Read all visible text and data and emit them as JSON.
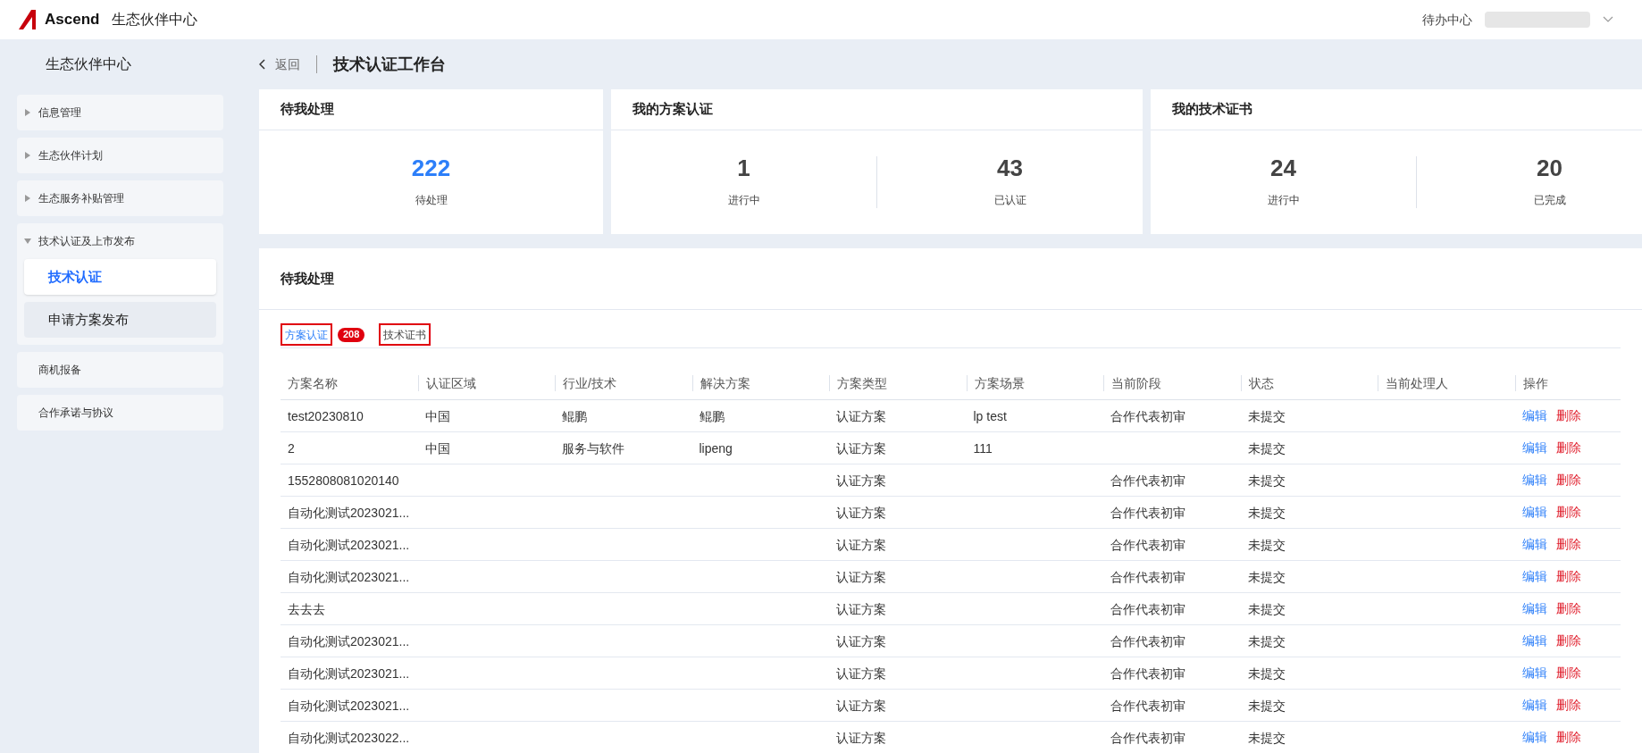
{
  "header": {
    "logo_text": "Ascend",
    "app_title": "生态伙伴中心",
    "todo_link": "待办中心"
  },
  "sidebar": {
    "title": "生态伙伴中心",
    "groups": [
      {
        "label": "信息管理",
        "kind": "folder",
        "expanded": false
      },
      {
        "label": "生态伙伴计划",
        "kind": "folder",
        "expanded": false
      },
      {
        "label": "生态服务补贴管理",
        "kind": "folder",
        "expanded": false
      },
      {
        "label": "技术认证及上市发布",
        "kind": "folder",
        "expanded": true,
        "children": [
          {
            "label": "技术认证",
            "selected": true
          },
          {
            "label": "申请方案发布",
            "selected": false
          }
        ]
      },
      {
        "label": "商机报备",
        "kind": "link"
      },
      {
        "label": "合作承诺与协议",
        "kind": "link"
      }
    ]
  },
  "page": {
    "back": "返回",
    "title": "技术认证工作台"
  },
  "cards": [
    {
      "title": "待我处理",
      "stats": [
        {
          "value": "222",
          "label": "待处理",
          "kind": "primary"
        }
      ]
    },
    {
      "title": "我的方案认证",
      "stats": [
        {
          "value": "1",
          "label": "进行中",
          "kind": "default"
        },
        {
          "value": "43",
          "label": "已认证",
          "kind": "default"
        }
      ]
    },
    {
      "title": "我的技术证书",
      "stats": [
        {
          "value": "24",
          "label": "进行中",
          "kind": "default"
        },
        {
          "value": "20",
          "label": "已完成",
          "kind": "default"
        }
      ]
    }
  ],
  "panel": {
    "title": "待我处理",
    "tabs": [
      {
        "label": "方案认证",
        "selected": true,
        "badge": "208"
      },
      {
        "label": "技术证书",
        "selected": false
      }
    ],
    "columns": [
      "方案名称",
      "认证区域",
      "行业/技术",
      "解决方案",
      "方案类型",
      "方案场景",
      "当前阶段",
      "状态",
      "当前处理人",
      "操作"
    ],
    "rows": [
      {
        "cells": [
          "test20230810",
          "中国",
          "鲲鹏",
          "鲲鹏",
          "认证方案",
          "lp test",
          "合作代表初审",
          "未提交",
          null
        ],
        "actions": [
          {
            "label": "编辑",
            "kind": "edit"
          },
          {
            "label": "删除",
            "kind": "delete"
          }
        ]
      },
      {
        "cells": [
          "2",
          "中国",
          "服务与软件",
          "lipeng",
          "认证方案",
          "111",
          null,
          "未提交",
          null
        ],
        "actions": [
          {
            "label": "编辑",
            "kind": "edit"
          },
          {
            "label": "删除",
            "kind": "delete"
          }
        ]
      },
      {
        "cells": [
          "1552808081020140",
          null,
          null,
          null,
          "认证方案",
          null,
          "合作代表初审",
          "未提交",
          null
        ],
        "actions": [
          {
            "label": "编辑",
            "kind": "edit"
          },
          {
            "label": "删除",
            "kind": "delete"
          }
        ]
      },
      {
        "cells": [
          "自动化测试2023021...",
          null,
          null,
          null,
          "认证方案",
          null,
          "合作代表初审",
          "未提交",
          null
        ],
        "actions": [
          {
            "label": "编辑",
            "kind": "edit"
          },
          {
            "label": "删除",
            "kind": "delete"
          }
        ]
      },
      {
        "cells": [
          "自动化测试2023021...",
          null,
          null,
          null,
          "认证方案",
          null,
          "合作代表初审",
          "未提交",
          null
        ],
        "actions": [
          {
            "label": "编辑",
            "kind": "edit"
          },
          {
            "label": "删除",
            "kind": "delete"
          }
        ]
      },
      {
        "cells": [
          "自动化测试2023021...",
          null,
          null,
          null,
          "认证方案",
          null,
          "合作代表初审",
          "未提交",
          null
        ],
        "actions": [
          {
            "label": "编辑",
            "kind": "edit"
          },
          {
            "label": "删除",
            "kind": "delete"
          }
        ]
      },
      {
        "cells": [
          "去去去",
          null,
          null,
          null,
          "认证方案",
          null,
          "合作代表初审",
          "未提交",
          null
        ],
        "actions": [
          {
            "label": "编辑",
            "kind": "edit"
          },
          {
            "label": "删除",
            "kind": "delete"
          }
        ]
      },
      {
        "cells": [
          "自动化测试2023021...",
          null,
          null,
          null,
          "认证方案",
          null,
          "合作代表初审",
          "未提交",
          null
        ],
        "actions": [
          {
            "label": "编辑",
            "kind": "edit"
          },
          {
            "label": "删除",
            "kind": "delete"
          }
        ]
      },
      {
        "cells": [
          "自动化测试2023021...",
          null,
          null,
          null,
          "认证方案",
          null,
          "合作代表初审",
          "未提交",
          null
        ],
        "actions": [
          {
            "label": "编辑",
            "kind": "edit"
          },
          {
            "label": "删除",
            "kind": "delete"
          }
        ]
      },
      {
        "cells": [
          "自动化测试2023021...",
          null,
          null,
          null,
          "认证方案",
          null,
          "合作代表初审",
          "未提交",
          null
        ],
        "actions": [
          {
            "label": "编辑",
            "kind": "edit"
          },
          {
            "label": "删除",
            "kind": "delete"
          }
        ]
      },
      {
        "cells": [
          "自动化测试2023022...",
          null,
          null,
          null,
          "认证方案",
          null,
          "合作代表初审",
          "未提交",
          null
        ],
        "actions": [
          {
            "label": "编辑",
            "kind": "edit"
          },
          {
            "label": "删除",
            "kind": "delete"
          }
        ]
      }
    ]
  }
}
